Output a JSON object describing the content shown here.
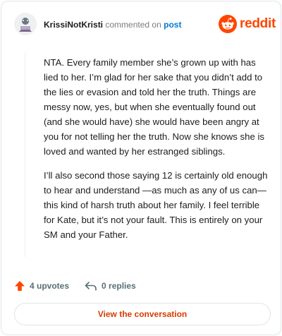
{
  "header": {
    "username": "KrissiNotKristi",
    "commented_on": "commented on",
    "post_link": "post",
    "brand": "reddit",
    "avatar_icon": "user-avatar-icon",
    "brand_icon": "reddit-alien-logo-icon"
  },
  "comment": {
    "paragraphs": [
      "NTA. Every family member she’s grown up with has lied to her. I’m glad for her sake that you didn’t add to the lies or evasion and told her the truth. Things are messy now, yes, but when she eventually found out (and she would have) she would have been angry at you for not telling her the truth. Now she knows she is loved and wanted by her estranged siblings.",
      "I’ll also second those saying 12 is certainly old enough to hear and understand —as much as any of us can— this kind of harsh truth about her family. I feel terrible for Kate, but it’s not your fault. This is entirely on your SM and your Father."
    ]
  },
  "actions": {
    "upvotes": "4 upvotes",
    "replies": "0 replies",
    "upvote_icon": "upvote-arrow-icon",
    "reply_icon": "reply-arrow-icon"
  },
  "cta": {
    "label": "View the conversation"
  },
  "colors": {
    "brand": "#ff4500",
    "link": "#0079d3",
    "cta": "#d93a00"
  }
}
